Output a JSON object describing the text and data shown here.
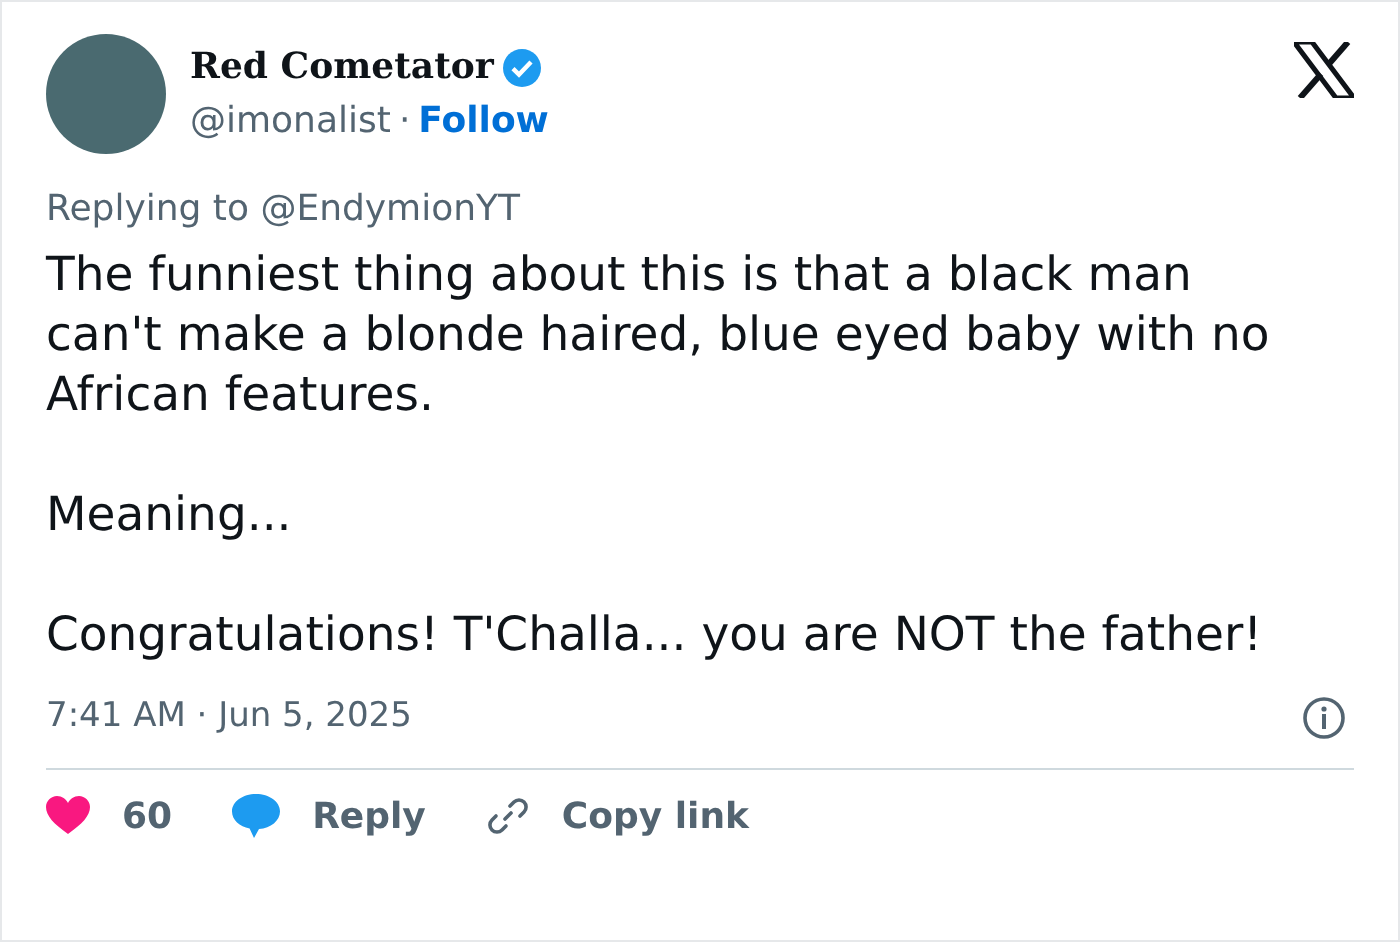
{
  "author": {
    "name": "Red Cometator",
    "verified": true,
    "handle": "@imonalist",
    "separator": "·",
    "follow": "Follow"
  },
  "replying_to": "Replying to @EndymionYT",
  "body": [
    "The funniest thing about this is that a black man can't make a blonde haired, blue eyed baby with no African features.",
    "Meaning...",
    "Congratulations! T'Challa... you are NOT the father!"
  ],
  "timestamp": "7:41 AM · Jun 5, 2025",
  "actions": [
    {
      "kind": "like",
      "label": "60"
    },
    {
      "kind": "reply",
      "label": "Reply"
    },
    {
      "kind": "copy",
      "label": "Copy link"
    }
  ]
}
